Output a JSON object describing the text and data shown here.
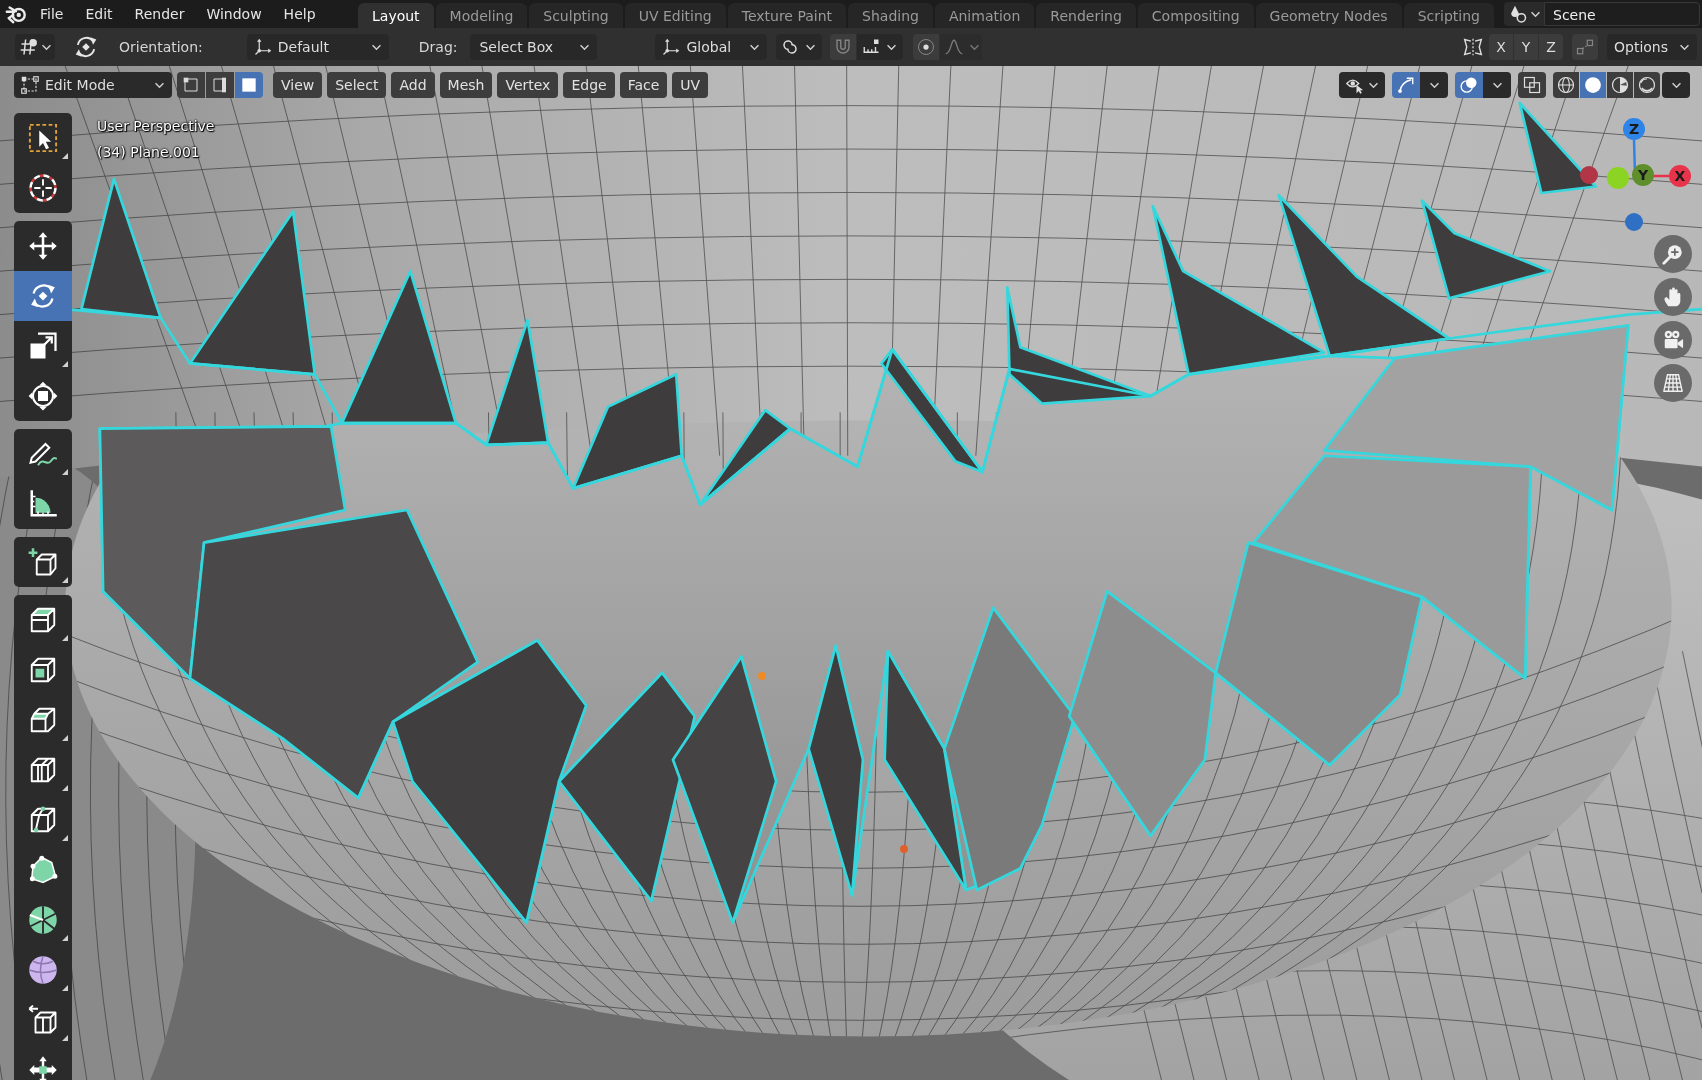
{
  "topbar": {
    "menus": [
      "File",
      "Edit",
      "Render",
      "Window",
      "Help"
    ],
    "workspaces": [
      {
        "label": "Layout",
        "selected": true
      },
      {
        "label": "Modeling",
        "selected": false
      },
      {
        "label": "Sculpting",
        "selected": false
      },
      {
        "label": "UV Editing",
        "selected": false
      },
      {
        "label": "Texture Paint",
        "selected": false
      },
      {
        "label": "Shading",
        "selected": false
      },
      {
        "label": "Animation",
        "selected": false
      },
      {
        "label": "Rendering",
        "selected": false
      },
      {
        "label": "Compositing",
        "selected": false
      },
      {
        "label": "Geometry Nodes",
        "selected": false
      },
      {
        "label": "Scripting",
        "selected": false
      }
    ],
    "scene": "Scene"
  },
  "tool_header": {
    "orientation_label": "Orientation:",
    "orientation": "Default",
    "drag_label": "Drag:",
    "drag": "Select Box",
    "transform_orientation": "Global",
    "mirror_axes": [
      {
        "label": "X",
        "on": false
      },
      {
        "label": "Y",
        "on": false
      },
      {
        "label": "Z",
        "on": false
      }
    ],
    "options": "Options"
  },
  "viewport_header": {
    "mode": "Edit Mode",
    "select_modes": [
      {
        "kind": "vertex",
        "selected": false
      },
      {
        "kind": "edge",
        "selected": false
      },
      {
        "kind": "face",
        "selected": true
      }
    ],
    "menus": [
      "View",
      "Select",
      "Add",
      "Mesh",
      "Vertex",
      "Edge",
      "Face",
      "UV"
    ],
    "toggles": [
      {
        "kind": "visibility",
        "on": false
      },
      {
        "kind": "gizmos",
        "on": true
      },
      {
        "kind": "overlays",
        "on": true
      },
      {
        "kind": "xray",
        "on": false
      }
    ],
    "shading": [
      {
        "kind": "wireframe",
        "selected": false
      },
      {
        "kind": "solid",
        "selected": true
      },
      {
        "kind": "material",
        "selected": false
      },
      {
        "kind": "rendered",
        "selected": false
      }
    ]
  },
  "toolbar": {
    "groups": [
      [
        {
          "kind": "select",
          "selected": false,
          "submenu": true
        },
        {
          "kind": "cursor",
          "selected": false,
          "submenu": false
        }
      ],
      [
        {
          "kind": "move",
          "selected": false,
          "submenu": false
        },
        {
          "kind": "rotate",
          "selected": true,
          "submenu": false
        },
        {
          "kind": "scale",
          "selected": false,
          "submenu": true
        },
        {
          "kind": "transform",
          "selected": false,
          "submenu": false
        }
      ],
      [
        {
          "kind": "annotate",
          "selected": false,
          "submenu": true
        },
        {
          "kind": "measure",
          "selected": false,
          "submenu": false
        }
      ],
      [
        {
          "kind": "addcube",
          "selected": false,
          "submenu": true
        }
      ],
      [
        {
          "kind": "extrude",
          "selected": false,
          "submenu": true
        },
        {
          "kind": "inset",
          "selected": false,
          "submenu": false
        },
        {
          "kind": "bevel",
          "selected": false,
          "submenu": true
        },
        {
          "kind": "loopcut",
          "selected": false,
          "submenu": true
        },
        {
          "kind": "knife",
          "selected": false,
          "submenu": true
        },
        {
          "kind": "polybuild",
          "selected": false,
          "submenu": false
        },
        {
          "kind": "spin",
          "selected": false,
          "submenu": true
        },
        {
          "kind": "smooth",
          "selected": false,
          "submenu": true
        },
        {
          "kind": "edgeslide",
          "selected": false,
          "submenu": true
        },
        {
          "kind": "shrink",
          "selected": false,
          "submenu": false
        }
      ]
    ]
  },
  "viewport": {
    "info": [
      "User Perspective",
      "(34) Plane.001"
    ],
    "gizmo_axes": [
      {
        "kind": "z",
        "label": "Z",
        "color": "#2f84e8"
      },
      {
        "kind": "y",
        "label": "Y",
        "color": "#5f8f2c"
      },
      {
        "kind": "x",
        "label": "X",
        "color": "#e8344a"
      }
    ],
    "nav_buttons": [
      {
        "kind": "zoom"
      },
      {
        "kind": "pan"
      },
      {
        "kind": "camera"
      },
      {
        "kind": "ortho"
      }
    ]
  }
}
